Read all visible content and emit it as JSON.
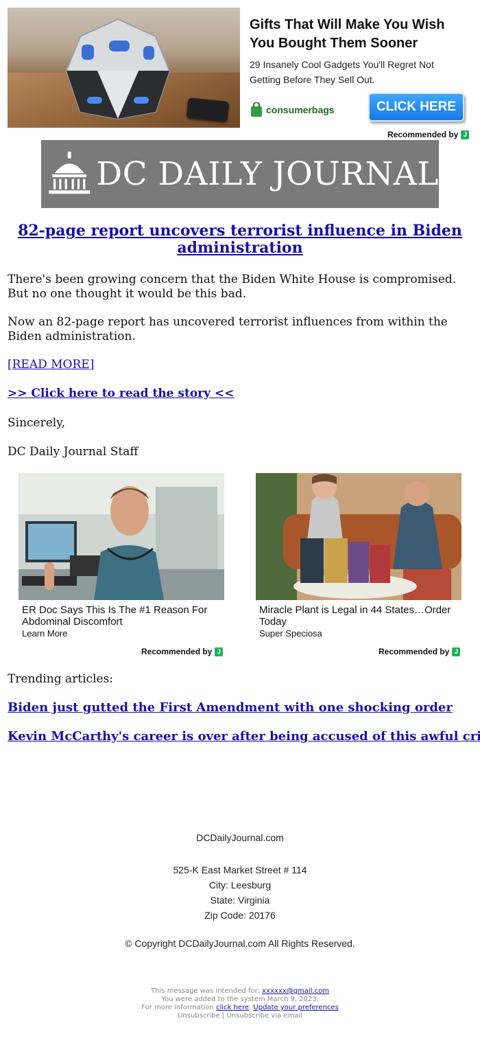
{
  "top_ad": {
    "headline": "Gifts That Will Make You Wish You Bought Them Sooner",
    "subtext": "29 Insanely Cool Gadgets You'll Regret Not Getting Before They Sell Out.",
    "brand": "consumerbags",
    "cta": "CLICK HERE",
    "recommended": "Recommended by"
  },
  "masthead": {
    "title": "DC DAILY JOURNAL"
  },
  "article": {
    "headline": "82-page report uncovers terrorist influence in Biden administration",
    "para1": "There's been growing concern that the Biden White House is compromised. But no one thought it would be this bad.",
    "para2": "Now an 82-page report has uncovered terrorist influences from within the Biden administration.",
    "read_more": "[READ MORE]",
    "story_link": ">> Click here to read the story <<",
    "sincerely": "Sincerely,",
    "signature": "DC Daily Journal Staff"
  },
  "ads": [
    {
      "title": "ER Doc Says This Is The #1 Reason For Abdominal Discomfort",
      "source": "Learn More",
      "recommended": "Recommended by"
    },
    {
      "title": "Miracle Plant is Legal in 44 States…Order Today",
      "source": "Super Speciosa",
      "recommended": "Recommended by"
    }
  ],
  "trending": {
    "label": "Trending articles:",
    "links": [
      "Biden just gutted the First Amendment with one shocking order",
      "Kevin McCarthy's career is over after being accused of this awful crime"
    ]
  },
  "footer": {
    "site": "DCDailyJournal.com",
    "street": "525-K East Market Street # 114",
    "city": "City: Leesburg",
    "state": "State: Virginia",
    "zip": "Zip Code: 20176",
    "copyright": "© Copyright DCDailyJournal.com All Rights Reserved."
  },
  "fine_print": {
    "intended_prefix": "This message was intended for:",
    "intended_email": "xxxxxx@gmail.com",
    "added": "You were added to the system March 9, 2023.",
    "info_prefix": "For more information",
    "click_here": "click here",
    "update_prefs": "Update your preferences",
    "unsubscribe": "Unsubscribe | Unsubscribe via email"
  },
  "colors": {
    "link": "#1a0dab",
    "masthead_bg": "#7a7a7a",
    "cta_blue": "#1479e6",
    "brand_green": "#22b15a"
  }
}
